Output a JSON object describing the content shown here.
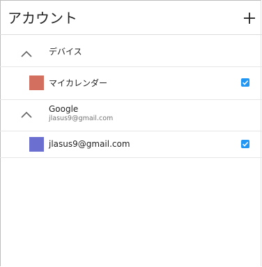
{
  "header": {
    "title": "アカウント",
    "add_icon": "plus-icon"
  },
  "sections": [
    {
      "label": "デバイス",
      "subtitle": "",
      "expanded": true,
      "calendars": [
        {
          "label": "マイカレンダー",
          "color": "#d26f5f",
          "checked": true
        }
      ]
    },
    {
      "label": "Google",
      "subtitle": "jlasus9@gmail.com",
      "expanded": true,
      "calendars": [
        {
          "label": "jlasus9@gmail.com",
          "color": "#6b6fd0",
          "checked": true
        }
      ]
    }
  ],
  "colors": {
    "checkbox_accent": "#2196f3",
    "divider": "#e6e6e6"
  }
}
